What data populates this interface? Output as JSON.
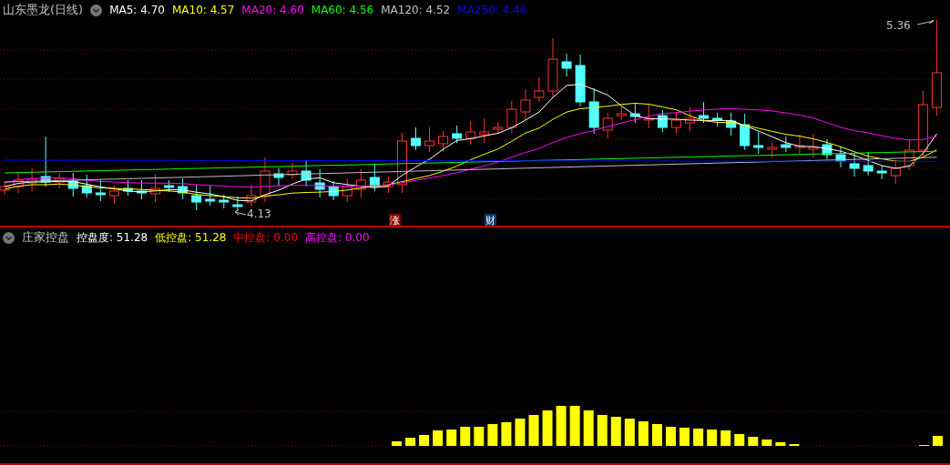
{
  "price_panel": {
    "title": "山东墨龙(日线)",
    "legend": [
      {
        "text": "MA5: 4.70",
        "color": "#ffffff"
      },
      {
        "text": "MA10: 4.57",
        "color": "#ffff00"
      },
      {
        "text": "MA20: 4.60",
        "color": "#ff00ff"
      },
      {
        "text": "MA60: 4.56",
        "color": "#00ff00"
      },
      {
        "text": "MA120: 4.52",
        "color": "#c0c0c0"
      },
      {
        "text": "MA250: 4.46",
        "color": "#0000ff"
      }
    ],
    "high_label": "5.36",
    "low_label": "4.13",
    "markers": [
      {
        "text": "涨",
        "color": "#8b0000"
      },
      {
        "text": "财",
        "color": "#0b3a6e"
      }
    ]
  },
  "indicator_panel": {
    "title": "庄家控盘",
    "legend": [
      {
        "text": "控盘度: 51.28",
        "color": "#ffffff"
      },
      {
        "text": "低控盘: 51.28",
        "color": "#ffff00"
      },
      {
        "text": "中控盘: 0.00",
        "color": "#ff0000"
      },
      {
        "text": "高控盘: 0.00",
        "color": "#ff00ff"
      }
    ]
  }
}
